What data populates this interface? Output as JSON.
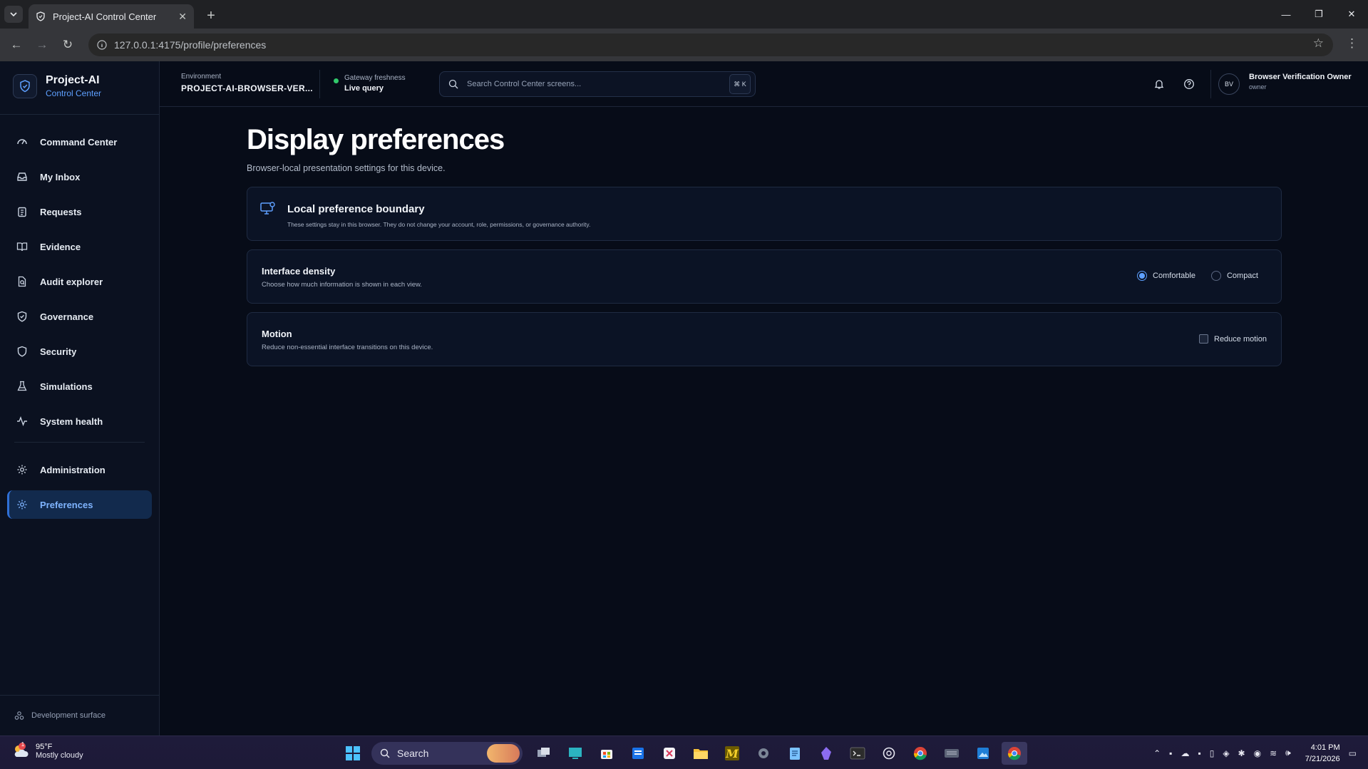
{
  "browser": {
    "tab_title": "Project-AI Control Center",
    "url": "127.0.0.1:4175/profile/preferences"
  },
  "brand": {
    "name": "Project-AI",
    "subtitle": "Control Center"
  },
  "nav": {
    "items": [
      {
        "label": "Command Center",
        "icon": "gauge-icon"
      },
      {
        "label": "My Inbox",
        "icon": "inbox-icon"
      },
      {
        "label": "Requests",
        "icon": "clipboard-icon"
      },
      {
        "label": "Evidence",
        "icon": "book-icon"
      },
      {
        "label": "Audit explorer",
        "icon": "file-search-icon"
      },
      {
        "label": "Governance",
        "icon": "shield-check-icon"
      },
      {
        "label": "Security",
        "icon": "shield-icon"
      },
      {
        "label": "Simulations",
        "icon": "flask-icon"
      },
      {
        "label": "System health",
        "icon": "activity-icon"
      }
    ],
    "admin_label": "Administration",
    "preferences_label": "Preferences",
    "footer": "Development surface"
  },
  "topbar": {
    "env_label": "Environment",
    "env_value": "PROJECT-AI-BROWSER-VER...",
    "fresh_label": "Gateway freshness",
    "fresh_value": "Live query",
    "search_placeholder": "Search Control Center screens...",
    "search_shortcut": "⌘ K",
    "user_initials": "BV",
    "user_name": "Browser Verification Owner",
    "user_role": "owner"
  },
  "page": {
    "title": "Display preferences",
    "subtitle": "Browser-local presentation settings for this device.",
    "boundary": {
      "title": "Local preference boundary",
      "desc": "These settings stay in this browser. They do not change your account, role, permissions, or governance authority."
    },
    "density": {
      "title": "Interface density",
      "desc": "Choose how much information is shown in each view.",
      "options": [
        "Comfortable",
        "Compact"
      ],
      "selected": "Comfortable"
    },
    "motion": {
      "title": "Motion",
      "desc": "Reduce non-essential interface transitions on this device.",
      "checkbox_label": "Reduce motion",
      "checked": false
    }
  },
  "taskbar": {
    "weather_temp": "95°F",
    "weather_desc": "Mostly cloudy",
    "weather_badge": "1",
    "search_label": "Search",
    "time": "4:01 PM",
    "date": "7/21/2026"
  },
  "colors": {
    "accent": "#5ea0ff",
    "active_nav_bg": "#122a4d",
    "status_live": "#31c96b"
  }
}
